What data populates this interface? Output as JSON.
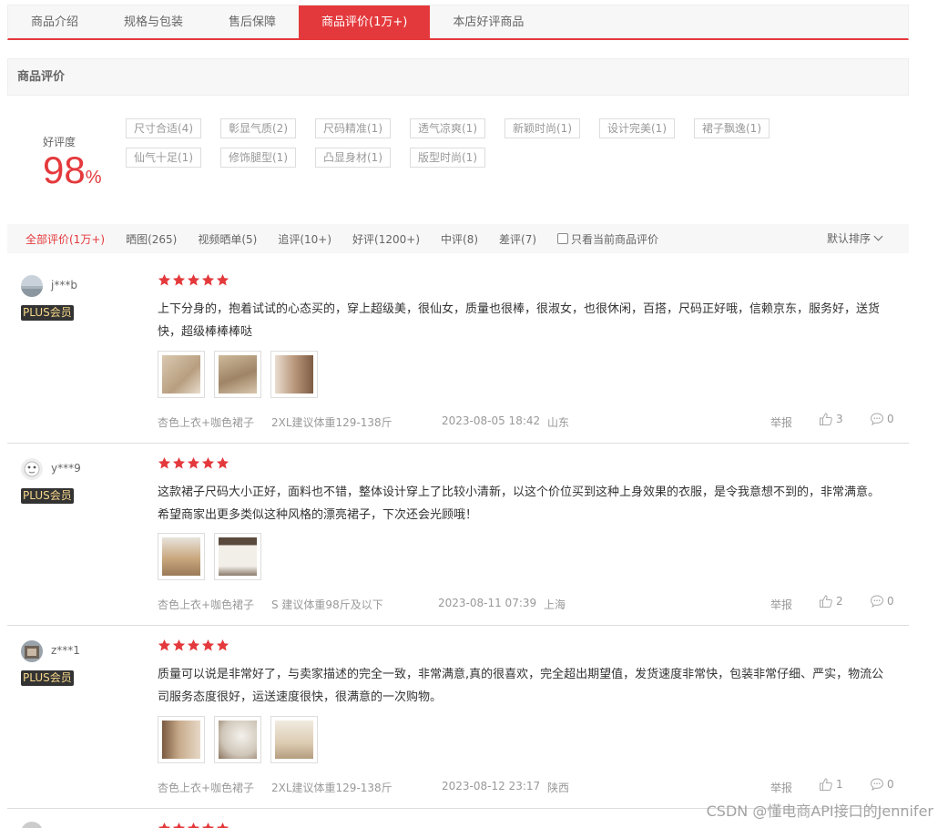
{
  "tabs": [
    {
      "label": "商品介绍"
    },
    {
      "label": "规格与包装"
    },
    {
      "label": "售后保障"
    },
    {
      "label": "商品评价(1万+)"
    },
    {
      "label": "本店好评商品"
    }
  ],
  "section_title": "商品评价",
  "rating": {
    "label": "好评度",
    "value": "98",
    "unit": "%"
  },
  "tags": [
    "尺寸合适(4)",
    "彰显气质(2)",
    "尺码精准(1)",
    "透气凉爽(1)",
    "新颖时尚(1)",
    "设计完美(1)",
    "裙子飘逸(1)",
    "仙气十足(1)",
    "修饰腿型(1)",
    "凸显身材(1)",
    "版型时尚(1)"
  ],
  "filters": [
    "全部评价(1万+)",
    "晒图(265)",
    "视频晒单(5)",
    "追评(10+)",
    "好评(1200+)",
    "中评(8)",
    "差评(7)"
  ],
  "only_current_label": "只看当前商品评价",
  "sort_label": "默认排序",
  "reviews": [
    {
      "user": "j***b",
      "badge": "PLUS会员",
      "content": "上下分身的，抱着试试的心态买的，穿上超级美，很仙女，质量也很棒，很淑女，也很休闲，百搭，尺码正好哦，信赖京东，服务好，送货快，超级棒棒棒哒",
      "color": "杏色上衣+咖色裙子",
      "size": "2XL建议体重129-138斤",
      "date": "2023-08-05 18:42",
      "location": "山东",
      "report": "举报",
      "likes": "3",
      "comments": "0"
    },
    {
      "user": "y***9",
      "badge": "PLUS会员",
      "content": "这款裙子尺码大小正好，面料也不错，整体设计穿上了比较小清新，以这个价位买到这种上身效果的衣服，是令我意想不到的，非常满意。希望商家出更多类似这种风格的漂亮裙子，下次还会光顾哦！",
      "color": "杏色上衣+咖色裙子",
      "size": "S 建议体重98斤及以下",
      "date": "2023-08-11 07:39",
      "location": "上海",
      "report": "举报",
      "likes": "2",
      "comments": "0"
    },
    {
      "user": "z***1",
      "badge": "PLUS会员",
      "content": "质量可以说是非常好了，与卖家描述的完全一致，非常满意,真的很喜欢，完全超出期望值，发货速度非常快，包装非常仔细、严实，物流公司服务态度很好，运送速度很快，很满意的一次购物。",
      "color": "杏色上衣+咖色裙子",
      "size": "2XL建议体重129-138斤",
      "date": "2023-08-12 23:17",
      "location": "陕西",
      "report": "举报",
      "likes": "1",
      "comments": "0"
    }
  ],
  "watermark": "CSDN @懂电商API接口的Jennifer",
  "colors": {
    "accent": "#e4393c"
  }
}
